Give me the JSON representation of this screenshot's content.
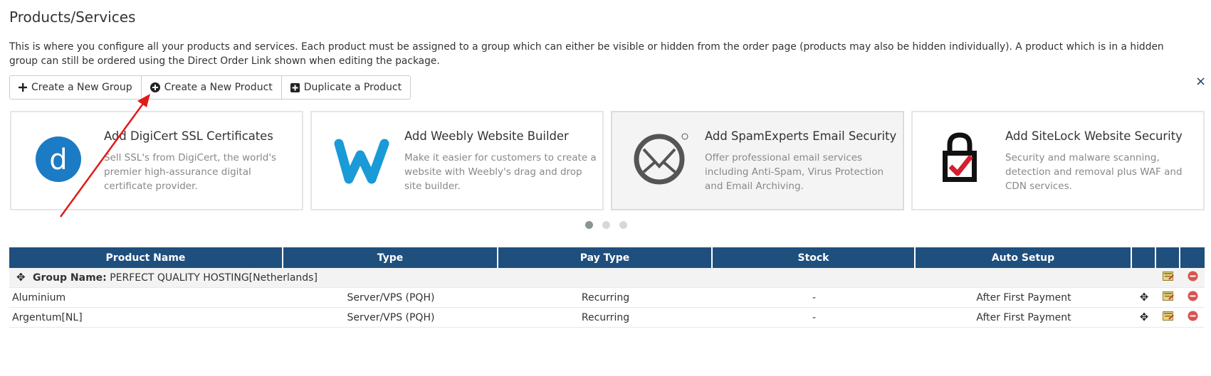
{
  "page": {
    "title": "Products/Services",
    "intro": "This is where you configure all your products and services. Each product must be assigned to a group which can either be visible or hidden from the order page (products may also be hidden individually). A product which is in a hidden group can still be ordered using the Direct Order Link shown when editing the package."
  },
  "actions": {
    "create_group": "Create a New Group",
    "create_product": "Create a New Product",
    "duplicate_product": "Duplicate a Product",
    "close_glyph": "×"
  },
  "promos": [
    {
      "logo_letter": "d",
      "title": "Add DigiCert SSL Certificates",
      "desc": "Sell SSL's from DigiCert, the world's premier high-assurance digital certificate provider.",
      "icon": "digicert-logo"
    },
    {
      "title": "Add Weebly Website Builder",
      "desc": "Make it easier for customers to create a website with Weebly's drag and drop site builder.",
      "icon": "weebly-logo"
    },
    {
      "title": "Add SpamExperts Email Security",
      "desc": "Offer professional email services including Anti-Spam, Virus Protection and Email Archiving.",
      "icon": "spamexperts-logo"
    },
    {
      "title": "Add SiteLock Website Security",
      "desc": "Security and malware scanning, detection and removal plus WAF and CDN services.",
      "icon": "sitelock-logo"
    }
  ],
  "carousel": {
    "count": 3,
    "active": 0
  },
  "table": {
    "headers": [
      "Product Name",
      "Type",
      "Pay Type",
      "Stock",
      "Auto Setup",
      "",
      "",
      ""
    ],
    "group": {
      "label": "Group Name:",
      "name": "PERFECT QUALITY HOSTING[Netherlands]"
    },
    "rows": [
      {
        "name": "Aluminium",
        "type": "Server/VPS (PQH)",
        "pay_type": "Recurring",
        "stock": "-",
        "auto_setup": "After First Payment"
      },
      {
        "name": "Argentum[NL]",
        "type": "Server/VPS (PQH)",
        "pay_type": "Recurring",
        "stock": "-",
        "auto_setup": "After First Payment"
      }
    ]
  },
  "icons": {
    "move": "✥",
    "edit": "edit-icon",
    "delete": "delete-icon"
  },
  "colors": {
    "header_bg": "#1f4f7d",
    "annotation_arrow": "#e01b1b",
    "delete_red": "#d9534f",
    "digicert_blue": "#1b7bc4",
    "weebly_blue": "#1a9ad6"
  }
}
